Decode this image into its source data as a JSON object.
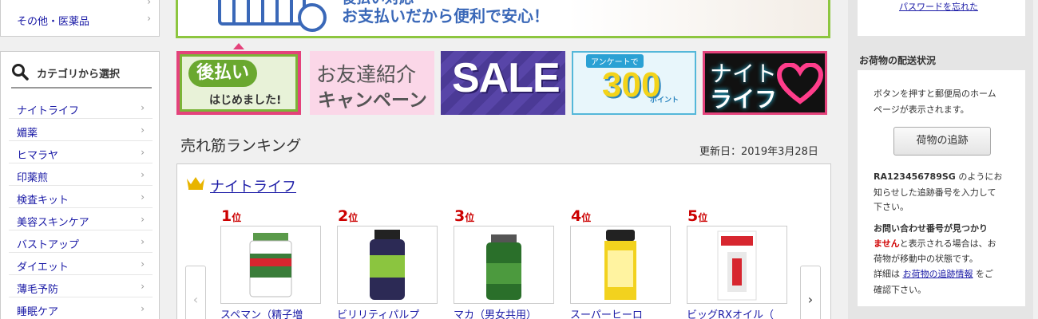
{
  "left_sidebar": {
    "top_items": [
      {
        "label": "その他・医薬品"
      }
    ],
    "category_heading": "カテゴリから選択",
    "categories": [
      {
        "label": "ナイトライフ"
      },
      {
        "label": "媚薬"
      },
      {
        "label": "ヒマラヤ"
      },
      {
        "label": "印薬煎"
      },
      {
        "label": "検査キット"
      },
      {
        "label": "美容スキンケア"
      },
      {
        "label": "バストアップ"
      },
      {
        "label": "ダイエット"
      },
      {
        "label": "薄毛予防"
      },
      {
        "label": "睡眠ケア"
      }
    ]
  },
  "banner": {
    "line1": "後払い対応",
    "line2": "お支払いだから便利で安心！"
  },
  "promos": {
    "atobarai": {
      "title": "後払い",
      "subtitle": "はじめました!"
    },
    "referral": {
      "line1": "お友達紹介",
      "line2": "キャンペーン"
    },
    "sale": {
      "text": "SALE"
    },
    "survey": {
      "tag": "アンケートで",
      "number": "300",
      "unit": "ポイント"
    },
    "nightlife": {
      "line1": "ナイト",
      "line2": "ライフ"
    }
  },
  "ranking": {
    "title": "売れ筋ランキング",
    "updated": "更新日：2019年3月28日",
    "category": "ナイトライフ",
    "items": [
      {
        "rank": "1",
        "suffix": "位",
        "name": "スペマン（精子増"
      },
      {
        "rank": "2",
        "suffix": "位",
        "name": "ビリリティパルプ"
      },
      {
        "rank": "3",
        "suffix": "位",
        "name": "マカ（男女共用）"
      },
      {
        "rank": "4",
        "suffix": "位",
        "name": "スーパーヒーロ"
      },
      {
        "rank": "5",
        "suffix": "位",
        "name": "ビッグRXオイル（"
      }
    ]
  },
  "right_sidebar": {
    "forgot_password": "パスワードを忘れた",
    "delivery_heading": "お荷物の配送状況",
    "delivery_desc1": "ボタンを押すと郵便局のホーム",
    "delivery_desc2": "ページが表示されます。",
    "track_button": "荷物の追跡",
    "tracking_example": "RA123456789SG",
    "tracking_text1": "のようにお",
    "tracking_text2": "知らせした追跡番号を入力して",
    "tracking_text3": "下さい。",
    "warning_red1": "お問い合わせ番号が見つかり",
    "warning_red2": "ません",
    "warning_text1": "と表示される場合は、お",
    "warning_text2": "荷物が移動中の状態です。",
    "detail_prefix": "詳細は",
    "detail_link": "お荷物の追跡情報",
    "detail_suffix": "をご",
    "detail_end": "確認下さい。"
  }
}
